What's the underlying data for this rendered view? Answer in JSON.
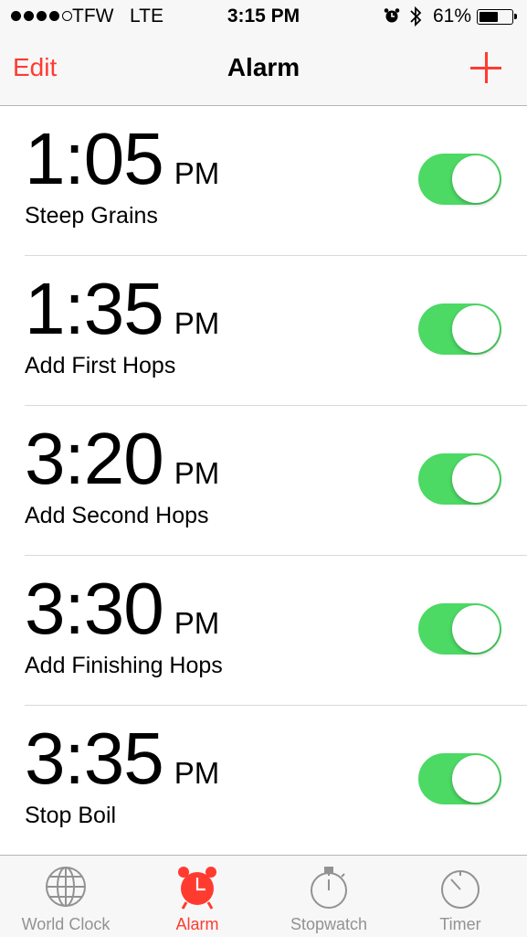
{
  "status_bar": {
    "carrier": "TFW",
    "network": "LTE",
    "time": "3:15 PM",
    "battery_percent": "61%",
    "battery_level": 0.61
  },
  "nav": {
    "edit": "Edit",
    "title": "Alarm"
  },
  "alarms": [
    {
      "time": "1:05",
      "ampm": "PM",
      "label": "Steep Grains",
      "enabled": true
    },
    {
      "time": "1:35",
      "ampm": "PM",
      "label": "Add First Hops",
      "enabled": true
    },
    {
      "time": "3:20",
      "ampm": "PM",
      "label": "Add Second Hops",
      "enabled": true
    },
    {
      "time": "3:30",
      "ampm": "PM",
      "label": "Add Finishing Hops",
      "enabled": true
    },
    {
      "time": "3:35",
      "ampm": "PM",
      "label": "Stop Boil",
      "enabled": true
    }
  ],
  "tabs": [
    {
      "label": "World Clock",
      "icon": "globe-icon",
      "active": false
    },
    {
      "label": "Alarm",
      "icon": "alarm-clock-icon",
      "active": true
    },
    {
      "label": "Stopwatch",
      "icon": "stopwatch-icon",
      "active": false
    },
    {
      "label": "Timer",
      "icon": "timer-icon",
      "active": false
    }
  ],
  "colors": {
    "accent": "#ff3b30",
    "toggle_on": "#4cd964",
    "inactive_tab": "#929292"
  }
}
